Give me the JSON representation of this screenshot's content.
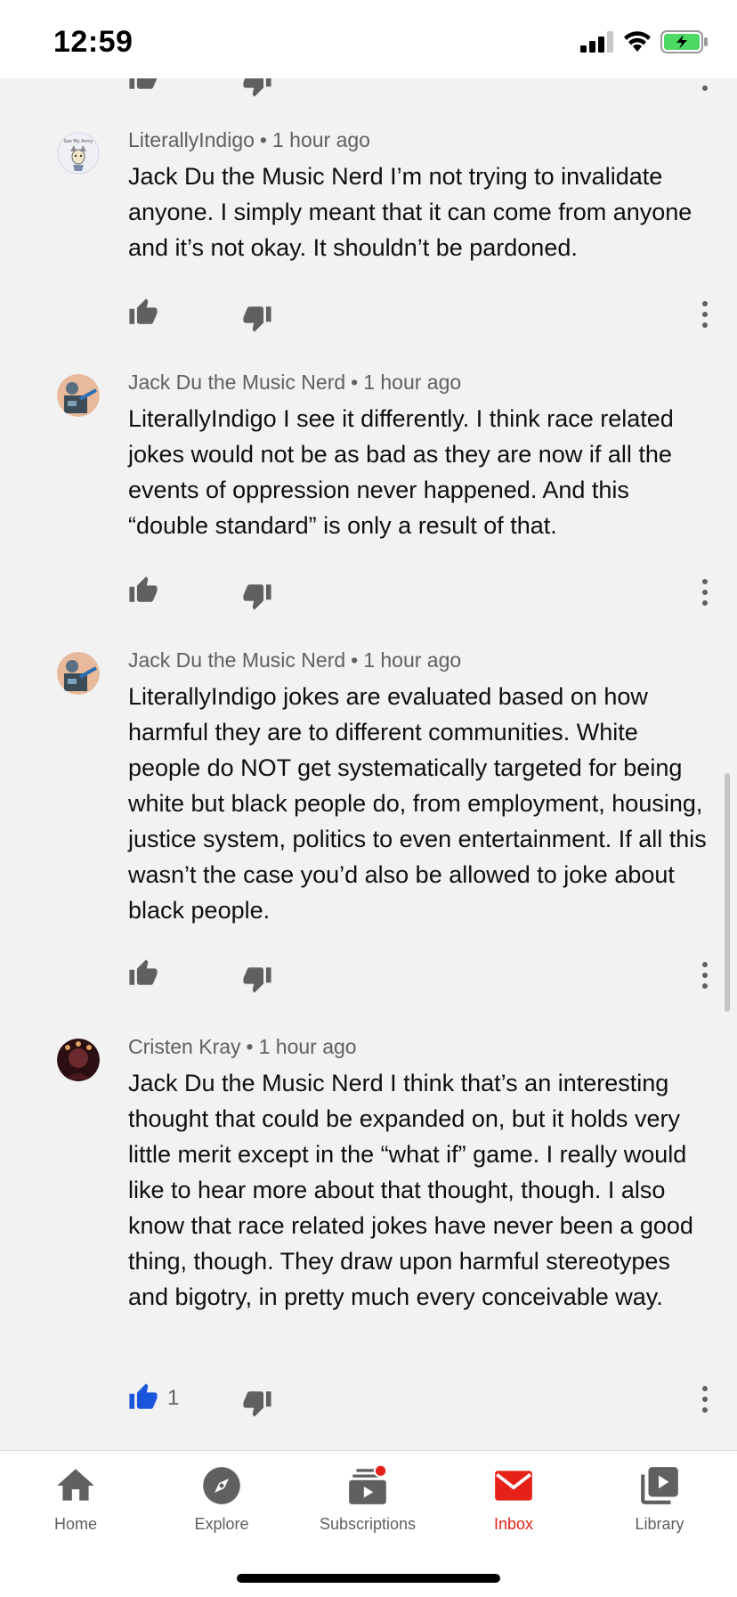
{
  "status": {
    "time": "12:59"
  },
  "comments": [
    {
      "author": "LiterallyIndigo",
      "time": "1 hour ago",
      "text": "Jack Du the Music Nerd I’m not trying to invalidate anyone. I simply meant that it can come from anyone and it’s not okay. It shouldn’t be pardoned.",
      "likes": "",
      "avatar_text": "See My Army"
    },
    {
      "author": "Jack Du the Music Nerd",
      "time": "1 hour ago",
      "text": "LiterallyIndigo I see it differently. I think race related jokes would not be as bad as they are now if all the events of oppression never happened. And this “double standard” is only a result of that.",
      "likes": ""
    },
    {
      "author": "Jack Du the Music Nerd",
      "time": "1 hour ago",
      "text": "LiterallyIndigo jokes are evaluated based on how harmful they are to different communities. White people do NOT get systematically targeted for being white but black people do, from employment, housing, justice system, politics to even entertainment. If all this wasn’t the case you’d also be allowed to joke about black people.",
      "likes": ""
    },
    {
      "author": "Cristen Kray",
      "time": "1 hour ago",
      "text": "Jack Du the Music Nerd I think that’s an interesting thought that could be expanded on, but it holds very little merit except in the “what if” game. I really would like to hear more about that thought, though. I also know that race related jokes have never been a good thing, though. They draw upon harmful stereotypes and bigotry, in pretty much every conceivable way.",
      "likes": "1"
    }
  ],
  "nav": {
    "home": "Home",
    "explore": "Explore",
    "subscriptions": "Subscriptions",
    "inbox": "Inbox",
    "library": "Library"
  },
  "colors": {
    "accent": "#e62117",
    "like_active": "#1a56db",
    "icon_gray": "#606060",
    "background": "#f2f2f2"
  }
}
